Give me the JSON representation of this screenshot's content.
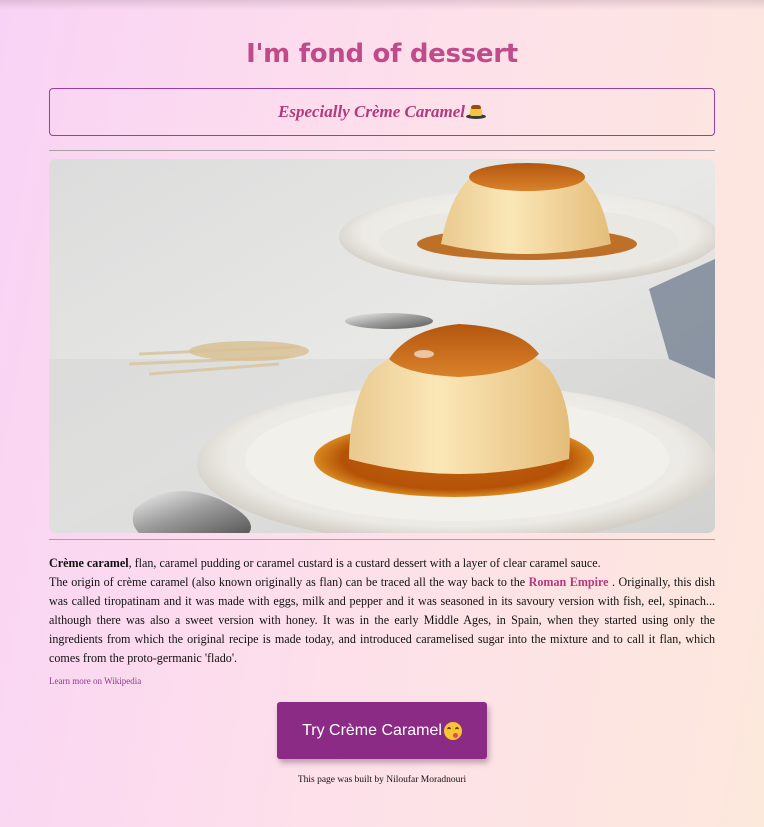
{
  "page": {
    "title": "I'm fond of dessert",
    "subtitle": "Especially Crème Caramel",
    "subtitle_icon": "flan-emoji"
  },
  "image": {
    "alt": "Crème Caramel"
  },
  "description": {
    "bold_term": "Crème caramel",
    "intro_rest": ", flan, caramel pudding or caramel custard is a custard dessert with a layer of clear caramel sauce.",
    "history_before_link": "The origin of crème caramel (also known originally as flan) can be traced all the way back to the ",
    "link_text": "Roman Empire",
    "history_after_link": " . Originally, this dish was called tiropatinam and it was made with eggs, milk and pepper and it was seasoned in its savoury version with fish, eel, spinach... although there was also a sweet version with honey. It was in the early Middle Ages, in Spain, when they started using only the ingredients from which the original recipe is made today, and introduced caramelised sugar into the mixture and to call it flan, which comes from the proto-germanic 'flado'."
  },
  "wiki_link": "Learn more on Wikipedia",
  "cta": {
    "label": "Try Crème Caramel",
    "icon": "yum-emoji"
  },
  "footer": "This page was built by Niloufar Moradnouri",
  "colors": {
    "title": "#c04b8a",
    "accent": "#8b2b86",
    "link": "#b4387d"
  }
}
